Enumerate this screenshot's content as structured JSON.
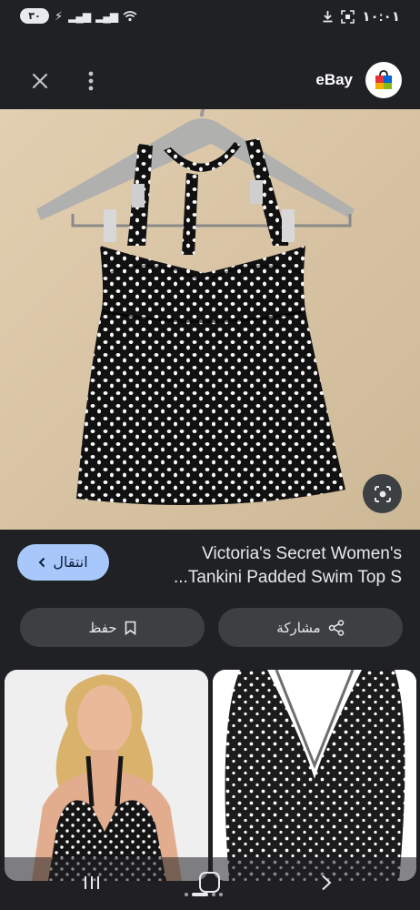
{
  "status_bar": {
    "time": "١٠:٠١",
    "battery": "٣٠"
  },
  "header": {
    "source_name": "eBay"
  },
  "result": {
    "title_line1": "Victoria's Secret Women's",
    "title_line2": "...Tankini Padded Swim Top S",
    "visit_label": "انتقال"
  },
  "actions": {
    "save_label": "حفظ",
    "share_label": "مشاركة"
  },
  "colors": {
    "background": "#202124",
    "visit_button": "#a8c7fa",
    "action_button": "#3c4043"
  },
  "icons": [
    "close-icon",
    "more-vert-icon",
    "ebay-logo-icon",
    "lens-search-icon",
    "chevron-left-icon",
    "bookmark-icon",
    "share-icon"
  ]
}
